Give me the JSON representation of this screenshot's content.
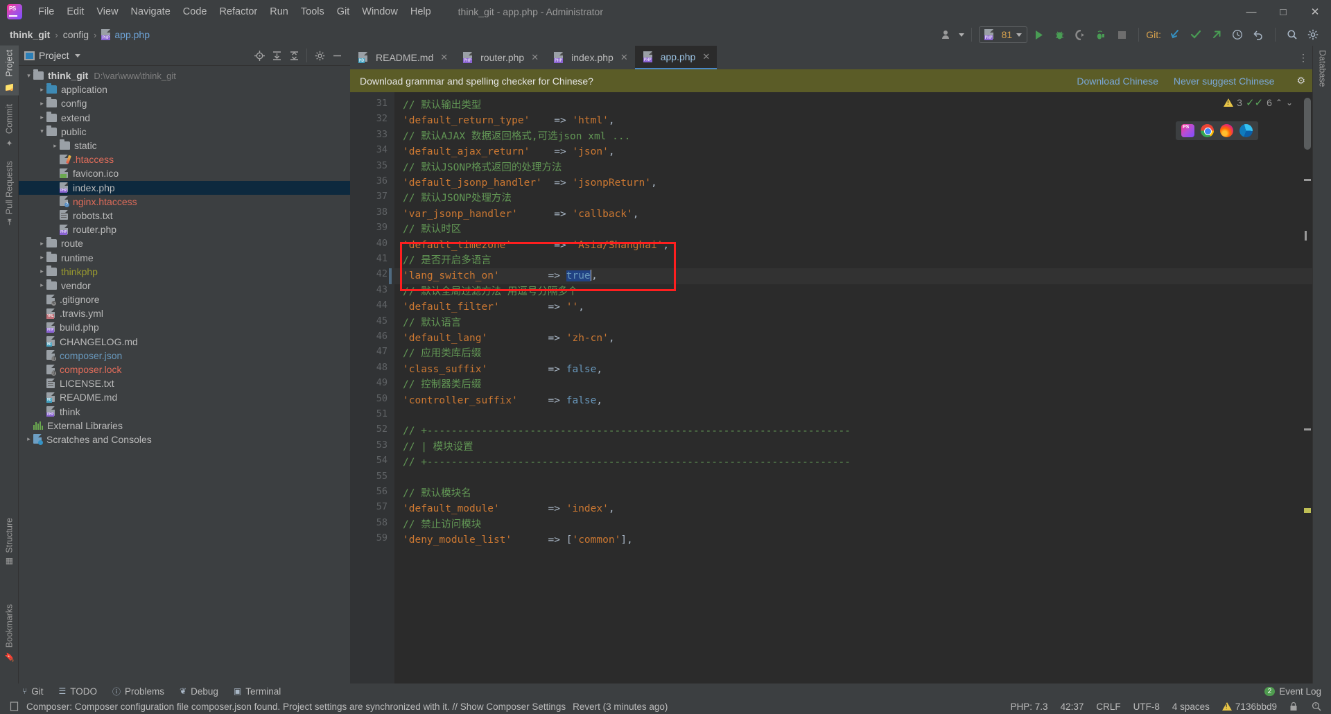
{
  "window": {
    "title": "think_git - app.php - Administrator",
    "controls": {
      "minimize": "—",
      "maximize": "□",
      "close": "✕"
    }
  },
  "menubar": {
    "items": [
      "File",
      "Edit",
      "View",
      "Navigate",
      "Code",
      "Refactor",
      "Run",
      "Tools",
      "Git",
      "Window",
      "Help"
    ]
  },
  "breadcrumb": {
    "project": "think_git",
    "folder": "config",
    "file": "app.php",
    "separator": "›"
  },
  "toolbar": {
    "run_config_label": "81",
    "git_label": "Git:",
    "icons": [
      "user-avatar-icon",
      "php-interpreter-icon",
      "run-icon",
      "debug-icon",
      "run-with-coverage-icon",
      "profile-icon",
      "stop-icon",
      "git-update-icon",
      "git-commit-icon",
      "git-push-icon",
      "history-icon",
      "rollback-icon",
      "search-everywhere-icon",
      "settings-icon"
    ]
  },
  "left_toolwindows": [
    {
      "label": "Project",
      "icon": "folder-icon",
      "active": true
    },
    {
      "label": "Commit",
      "icon": "commit-icon",
      "active": false
    },
    {
      "label": "Pull Requests",
      "icon": "pull-request-icon",
      "active": false
    },
    {
      "label": "Structure",
      "icon": "structure-icon",
      "active": false
    },
    {
      "label": "Bookmarks",
      "icon": "bookmark-icon",
      "active": false
    }
  ],
  "right_toolwindows": [
    {
      "label": "Database",
      "icon": "database-icon"
    }
  ],
  "project_panel": {
    "title": "Project",
    "header_icons": [
      "locate-icon",
      "expand-all-icon",
      "collapse-all-icon",
      "gear-icon",
      "hide-icon"
    ],
    "tree": [
      {
        "depth": 0,
        "arrow": "down",
        "icon": "folder",
        "label": "think_git",
        "bold": true,
        "path": "D:\\var\\www\\think_git",
        "color": ""
      },
      {
        "depth": 1,
        "arrow": "right",
        "icon": "folder-blue",
        "label": "application",
        "color": ""
      },
      {
        "depth": 1,
        "arrow": "right",
        "icon": "folder",
        "label": "config",
        "color": ""
      },
      {
        "depth": 1,
        "arrow": "right",
        "icon": "folder",
        "label": "extend",
        "color": ""
      },
      {
        "depth": 1,
        "arrow": "down",
        "icon": "folder",
        "label": "public",
        "color": ""
      },
      {
        "depth": 2,
        "arrow": "right",
        "icon": "folder",
        "label": "static",
        "color": ""
      },
      {
        "depth": 2,
        "arrow": "",
        "icon": "file-htaccess",
        "label": ".htaccess",
        "color": "orange"
      },
      {
        "depth": 2,
        "arrow": "",
        "icon": "file-image",
        "label": "favicon.ico",
        "color": ""
      },
      {
        "depth": 2,
        "arrow": "",
        "icon": "file-php",
        "label": "index.php",
        "color": "",
        "selected": true
      },
      {
        "depth": 2,
        "arrow": "",
        "icon": "file-unknown",
        "label": "nginx.htaccess",
        "color": "orange"
      },
      {
        "depth": 2,
        "arrow": "",
        "icon": "file-txt",
        "label": "robots.txt",
        "color": ""
      },
      {
        "depth": 2,
        "arrow": "",
        "icon": "file-php",
        "label": "router.php",
        "color": ""
      },
      {
        "depth": 1,
        "arrow": "right",
        "icon": "folder",
        "label": "route",
        "color": ""
      },
      {
        "depth": 1,
        "arrow": "right",
        "icon": "folder",
        "label": "runtime",
        "color": ""
      },
      {
        "depth": 1,
        "arrow": "right",
        "icon": "folder",
        "label": "thinkphp",
        "color": "olive"
      },
      {
        "depth": 1,
        "arrow": "right",
        "icon": "folder",
        "label": "vendor",
        "color": ""
      },
      {
        "depth": 1,
        "arrow": "",
        "icon": "file-ignore",
        "label": ".gitignore",
        "color": ""
      },
      {
        "depth": 1,
        "arrow": "",
        "icon": "file-yml",
        "label": ".travis.yml",
        "color": ""
      },
      {
        "depth": 1,
        "arrow": "",
        "icon": "file-php",
        "label": "build.php",
        "color": ""
      },
      {
        "depth": 1,
        "arrow": "",
        "icon": "file-md",
        "label": "CHANGELOG.md",
        "color": ""
      },
      {
        "depth": 1,
        "arrow": "",
        "icon": "file-json",
        "label": "composer.json",
        "color": "blue"
      },
      {
        "depth": 1,
        "arrow": "",
        "icon": "file-json",
        "label": "composer.lock",
        "color": "orange"
      },
      {
        "depth": 1,
        "arrow": "",
        "icon": "file-txt",
        "label": "LICENSE.txt",
        "color": ""
      },
      {
        "depth": 1,
        "arrow": "",
        "icon": "file-md",
        "label": "README.md",
        "color": ""
      },
      {
        "depth": 1,
        "arrow": "",
        "icon": "file-php",
        "label": "think",
        "color": ""
      },
      {
        "depth": 0,
        "arrow": "",
        "icon": "ext-libs",
        "label": "External Libraries",
        "color": ""
      },
      {
        "depth": 0,
        "arrow": "right",
        "icon": "scratches",
        "label": "Scratches and Consoles",
        "color": ""
      }
    ]
  },
  "editor": {
    "tabs": [
      {
        "label": "README.md",
        "icon": "md-file-icon",
        "active": false
      },
      {
        "label": "router.php",
        "icon": "php-file-icon",
        "active": false
      },
      {
        "label": "index.php",
        "icon": "php-file-icon",
        "active": false
      },
      {
        "label": "app.php",
        "icon": "php-file-icon",
        "active": true
      }
    ],
    "close_glyph": "✕",
    "inspection": {
      "warning_count": "3",
      "check_count": "6",
      "up": "⌃",
      "down": "⌄"
    },
    "browser_popup": [
      "phpstorm-icon",
      "chrome-icon",
      "firefox-icon",
      "edge-icon"
    ],
    "banner": {
      "message": "Download grammar and spelling checker for Chinese?",
      "action_primary": "Download Chinese",
      "action_secondary": "Never suggest Chinese",
      "gear_icon": "gear-icon"
    },
    "first_line_number": 31,
    "caret_line_number": 42,
    "lines": [
      {
        "n": 31,
        "tokens": [
          {
            "t": "com",
            "v": "// 默认输出类型"
          }
        ]
      },
      {
        "n": 32,
        "tokens": [
          {
            "t": "str",
            "v": "'default_return_type'"
          },
          {
            "t": "plain",
            "v": "    "
          },
          {
            "t": "op",
            "v": "=>"
          },
          {
            "t": "plain",
            "v": " "
          },
          {
            "t": "str",
            "v": "'html'"
          },
          {
            "t": "op",
            "v": ","
          }
        ]
      },
      {
        "n": 33,
        "tokens": [
          {
            "t": "com",
            "v": "// 默认AJAX 数据返回格式,可选json xml ..."
          }
        ]
      },
      {
        "n": 34,
        "tokens": [
          {
            "t": "str",
            "v": "'default_ajax_return'"
          },
          {
            "t": "plain",
            "v": "    "
          },
          {
            "t": "op",
            "v": "=>"
          },
          {
            "t": "plain",
            "v": " "
          },
          {
            "t": "str",
            "v": "'json'"
          },
          {
            "t": "op",
            "v": ","
          }
        ]
      },
      {
        "n": 35,
        "tokens": [
          {
            "t": "com",
            "v": "// 默认JSONP格式返回的处理方法"
          }
        ]
      },
      {
        "n": 36,
        "tokens": [
          {
            "t": "str",
            "v": "'default_jsonp_handler'"
          },
          {
            "t": "plain",
            "v": "  "
          },
          {
            "t": "op",
            "v": "=>"
          },
          {
            "t": "plain",
            "v": " "
          },
          {
            "t": "str",
            "v": "'jsonpReturn'"
          },
          {
            "t": "op",
            "v": ","
          }
        ]
      },
      {
        "n": 37,
        "tokens": [
          {
            "t": "com",
            "v": "// 默认JSONP处理方法"
          }
        ]
      },
      {
        "n": 38,
        "tokens": [
          {
            "t": "str",
            "v": "'var_jsonp_handler'"
          },
          {
            "t": "plain",
            "v": "      "
          },
          {
            "t": "op",
            "v": "=>"
          },
          {
            "t": "plain",
            "v": " "
          },
          {
            "t": "str",
            "v": "'callback'"
          },
          {
            "t": "op",
            "v": ","
          }
        ]
      },
      {
        "n": 39,
        "tokens": [
          {
            "t": "com",
            "v": "// 默认时区"
          }
        ]
      },
      {
        "n": 40,
        "tokens": [
          {
            "t": "str",
            "v": "'default_timezone'"
          },
          {
            "t": "plain",
            "v": "       "
          },
          {
            "t": "op",
            "v": "=>"
          },
          {
            "t": "plain",
            "v": " "
          },
          {
            "t": "str",
            "v": "'Asia/Shanghai'"
          },
          {
            "t": "op",
            "v": ","
          }
        ]
      },
      {
        "n": 41,
        "tokens": [
          {
            "t": "com",
            "v": "// 是否开启多语言"
          }
        ]
      },
      {
        "n": 42,
        "tokens": [
          {
            "t": "str",
            "v": "'lang_switch_on'"
          },
          {
            "t": "plain",
            "v": "        "
          },
          {
            "t": "op",
            "v": "=>"
          },
          {
            "t": "plain",
            "v": " "
          },
          {
            "t": "sel-bool",
            "v": "true"
          },
          {
            "t": "op",
            "v": ","
          }
        ]
      },
      {
        "n": 43,
        "tokens": [
          {
            "t": "com",
            "v": "// 默认全局过滤方法 用逗号分隔多个"
          }
        ]
      },
      {
        "n": 44,
        "tokens": [
          {
            "t": "str",
            "v": "'default_filter'"
          },
          {
            "t": "plain",
            "v": "        "
          },
          {
            "t": "op",
            "v": "=>"
          },
          {
            "t": "plain",
            "v": " "
          },
          {
            "t": "str",
            "v": "''"
          },
          {
            "t": "op",
            "v": ","
          }
        ]
      },
      {
        "n": 45,
        "tokens": [
          {
            "t": "com",
            "v": "// 默认语言"
          }
        ]
      },
      {
        "n": 46,
        "tokens": [
          {
            "t": "str",
            "v": "'default_lang'"
          },
          {
            "t": "plain",
            "v": "          "
          },
          {
            "t": "op",
            "v": "=>"
          },
          {
            "t": "plain",
            "v": " "
          },
          {
            "t": "str",
            "v": "'zh-cn'"
          },
          {
            "t": "op",
            "v": ","
          }
        ]
      },
      {
        "n": 47,
        "tokens": [
          {
            "t": "com",
            "v": "// 应用类库后缀"
          }
        ]
      },
      {
        "n": 48,
        "tokens": [
          {
            "t": "str",
            "v": "'class_suffix'"
          },
          {
            "t": "plain",
            "v": "          "
          },
          {
            "t": "op",
            "v": "=>"
          },
          {
            "t": "plain",
            "v": " "
          },
          {
            "t": "bool",
            "v": "false"
          },
          {
            "t": "op",
            "v": ","
          }
        ]
      },
      {
        "n": 49,
        "tokens": [
          {
            "t": "com",
            "v": "// 控制器类后缀"
          }
        ]
      },
      {
        "n": 50,
        "tokens": [
          {
            "t": "str",
            "v": "'controller_suffix'"
          },
          {
            "t": "plain",
            "v": "     "
          },
          {
            "t": "op",
            "v": "=>"
          },
          {
            "t": "plain",
            "v": " "
          },
          {
            "t": "bool",
            "v": "false"
          },
          {
            "t": "op",
            "v": ","
          }
        ]
      },
      {
        "n": 51,
        "tokens": []
      },
      {
        "n": 52,
        "tokens": [
          {
            "t": "com",
            "v": "// +----------------------------------------------------------------------"
          }
        ]
      },
      {
        "n": 53,
        "tokens": [
          {
            "t": "com",
            "v": "// | 模块设置"
          }
        ]
      },
      {
        "n": 54,
        "tokens": [
          {
            "t": "com",
            "v": "// +----------------------------------------------------------------------"
          }
        ]
      },
      {
        "n": 55,
        "tokens": []
      },
      {
        "n": 56,
        "tokens": [
          {
            "t": "com",
            "v": "// 默认模块名"
          }
        ]
      },
      {
        "n": 57,
        "tokens": [
          {
            "t": "str",
            "v": "'default_module'"
          },
          {
            "t": "plain",
            "v": "        "
          },
          {
            "t": "op",
            "v": "=>"
          },
          {
            "t": "plain",
            "v": " "
          },
          {
            "t": "str",
            "v": "'index'"
          },
          {
            "t": "op",
            "v": ","
          }
        ]
      },
      {
        "n": 58,
        "tokens": [
          {
            "t": "com",
            "v": "// 禁止访问模块"
          }
        ]
      },
      {
        "n": 59,
        "tokens": [
          {
            "t": "str",
            "v": "'deny_module_list'"
          },
          {
            "t": "plain",
            "v": "      "
          },
          {
            "t": "op",
            "v": "=>"
          },
          {
            "t": "plain",
            "v": " "
          },
          {
            "t": "op",
            "v": "["
          },
          {
            "t": "str",
            "v": "'common'"
          },
          {
            "t": "op",
            "v": "],"
          }
        ]
      }
    ],
    "annotation": {
      "type": "red-rectangle",
      "from_line": 40,
      "to_line": 43,
      "color": "#ff1f1f"
    }
  },
  "bottom_toolwindows": {
    "items": [
      {
        "label": "Git",
        "icon": "git-branch-icon"
      },
      {
        "label": "TODO",
        "icon": "todo-list-icon"
      },
      {
        "label": "Problems",
        "icon": "problems-icon"
      },
      {
        "label": "Debug",
        "icon": "debug-bug-icon"
      },
      {
        "label": "Terminal",
        "icon": "terminal-icon"
      }
    ],
    "event_log": {
      "label": "Event Log",
      "count": "2"
    }
  },
  "statusbar": {
    "message": "Composer: Composer configuration file composer.json found. Project settings are synchronized with it. // Show Composer Settings",
    "revert": "Revert (3 minutes ago)",
    "message_icon": "notification-icon",
    "right": {
      "php_version": "PHP: 7.3",
      "caret_position": "42:37",
      "line_separator": "CRLF",
      "encoding": "UTF-8",
      "indent": "4 spaces",
      "git_branch": "7136bbd9",
      "lock_icon": "lock-icon",
      "inspection_icon": "inspection-icon",
      "warning_icon": "warning-icon"
    }
  }
}
